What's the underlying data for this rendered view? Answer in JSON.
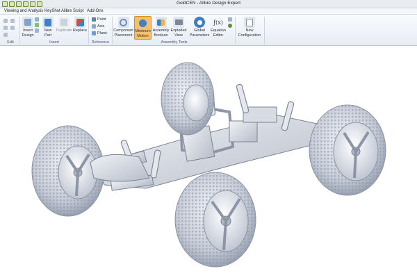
{
  "window": {
    "title": "GoldCEN - Alibre Design Expert"
  },
  "menu": [
    "Viewing and Analysis",
    "KeyShot",
    "Alibre Script",
    "Add-Ons"
  ],
  "ribbon": {
    "buttons": {
      "insert_design": "Insert\nDesign",
      "new_part": "New\nPart",
      "duplicate": "Duplicate",
      "replace": "Replace",
      "point": "Point",
      "axis": "Axis",
      "plane": "Plane",
      "component_placement": "Component\nPlacement",
      "minimum_motion": "Minimum\nMotion",
      "assembly_boolean": "Assembly\nBoolean",
      "exploded_view": "Exploded\nView",
      "global_parameters": "Global\nParameters",
      "equation_editor": "Equation\nEditor",
      "new_configuration": "New\nConfiguration"
    },
    "groups": {
      "edit": "Edit",
      "insert": "Insert",
      "reference": "Reference",
      "assembly_tools": "Assembly Tools"
    }
  },
  "viewport": {
    "model": "RC monster truck chassis assembly"
  },
  "colors": {
    "accent": "#f6c069",
    "model": "#c9ced8",
    "ribbon_bg": "#e8edf4"
  }
}
